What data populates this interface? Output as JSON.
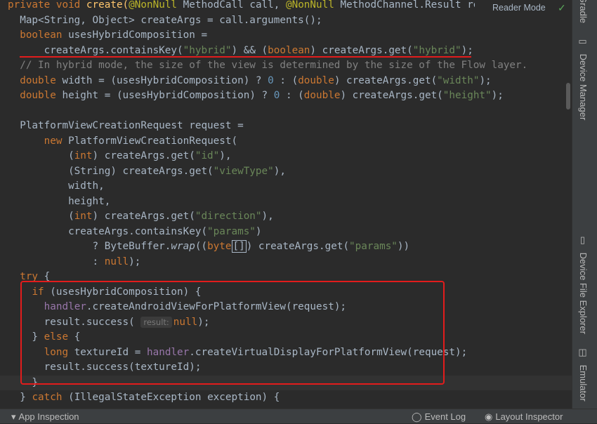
{
  "editor": {
    "reader_mode_label": "Reader Mode",
    "code_lines": [
      [
        [
          "private void ",
          "kw"
        ],
        [
          "create(",
          "fn"
        ],
        [
          "@NonNull",
          "ann"
        ],
        [
          " MethodCall call, ",
          ""
        ],
        [
          "@NonNull",
          "ann"
        ],
        [
          " MethodChannel.Result result)",
          ""
        ]
      ],
      [
        [
          "  Map<String, Object> createArgs = call.arguments();",
          ""
        ]
      ],
      [
        [
          "  boolean",
          "kw"
        ],
        [
          " usesHybridComposition =",
          ""
        ]
      ],
      [
        [
          "      createArgs.containsKey(",
          ""
        ],
        [
          "\"hybrid\"",
          "str"
        ],
        [
          ") && (",
          ""
        ],
        [
          "boolean",
          "kw"
        ],
        [
          ") createArgs.get(",
          ""
        ],
        [
          "\"hybrid\"",
          "str"
        ],
        [
          ");",
          ""
        ]
      ],
      [
        [
          "  // In hybrid mode, the size of the view is determined by the size of the Flow layer.",
          "cm"
        ]
      ],
      [
        [
          "  double",
          "kw"
        ],
        [
          " width = (usesHybridComposition) ? ",
          ""
        ],
        [
          "0",
          "num"
        ],
        [
          " : (",
          ""
        ],
        [
          "double",
          "kw"
        ],
        [
          ") createArgs.get(",
          ""
        ],
        [
          "\"width\"",
          "str"
        ],
        [
          ");",
          ""
        ]
      ],
      [
        [
          "  double",
          "kw"
        ],
        [
          " height = (usesHybridComposition) ? ",
          ""
        ],
        [
          "0",
          "num"
        ],
        [
          " : (",
          ""
        ],
        [
          "double",
          "kw"
        ],
        [
          ") createArgs.get(",
          ""
        ],
        [
          "\"height\"",
          "str"
        ],
        [
          ");",
          ""
        ]
      ],
      [],
      [
        [
          "  PlatformViewCreationRequest request =",
          ""
        ]
      ],
      [
        [
          "      ",
          ""
        ],
        [
          "new",
          "kw"
        ],
        [
          " PlatformViewCreationRequest(",
          ""
        ]
      ],
      [
        [
          "          (",
          ""
        ],
        [
          "int",
          "kw"
        ],
        [
          ") createArgs.get(",
          ""
        ],
        [
          "\"id\"",
          "str"
        ],
        [
          "),",
          ""
        ]
      ],
      [
        [
          "          (String) createArgs.get(",
          ""
        ],
        [
          "\"viewType\"",
          "str"
        ],
        [
          "),",
          ""
        ]
      ],
      [
        [
          "          width,",
          ""
        ]
      ],
      [
        [
          "          height,",
          ""
        ]
      ],
      [
        [
          "          (",
          ""
        ],
        [
          "int",
          "kw"
        ],
        [
          ") createArgs.get(",
          ""
        ],
        [
          "\"direction\"",
          "str"
        ],
        [
          "),",
          ""
        ]
      ],
      [
        [
          "          createArgs.containsKey(",
          ""
        ],
        [
          "\"params\"",
          "str"
        ],
        [
          ")",
          ""
        ]
      ],
      [
        [
          "              ? ByteBuffer.",
          ""
        ],
        [
          "wrap",
          "it"
        ],
        [
          "((",
          ""
        ],
        [
          "byte",
          "kw"
        ],
        [
          "[]",
          "box"
        ],
        [
          ") createArgs.get(",
          ""
        ],
        [
          "\"params\"",
          "str"
        ],
        [
          "))",
          ""
        ]
      ],
      [
        [
          "              : ",
          ""
        ],
        [
          "null",
          "kw"
        ],
        [
          ");",
          ""
        ]
      ],
      [
        [
          "  try",
          "kw"
        ],
        [
          " {",
          ""
        ]
      ],
      [
        [
          "    ",
          ""
        ],
        [
          "if",
          "kw"
        ],
        [
          " (usesHybridComposition) {",
          ""
        ]
      ],
      [
        [
          "      ",
          ""
        ],
        [
          "handler",
          "field"
        ],
        [
          ".createAndroidViewForPlatformView(request);",
          ""
        ]
      ],
      [
        [
          "      result.success( ",
          ""
        ],
        [
          "result:",
          "hint"
        ],
        [
          "null",
          "kw"
        ],
        [
          ");",
          ""
        ]
      ],
      [
        [
          "    } ",
          ""
        ],
        [
          "else",
          "kw"
        ],
        [
          " {",
          ""
        ]
      ],
      [
        [
          "      ",
          ""
        ],
        [
          "long",
          "kw"
        ],
        [
          " textureId = ",
          ""
        ],
        [
          "handler",
          "field"
        ],
        [
          ".createVirtualDisplayForPlatformView(request);",
          ""
        ]
      ],
      [
        [
          "      result.success(textureId);",
          ""
        ]
      ],
      [
        [
          "    }",
          ""
        ]
      ],
      [
        [
          "  } ",
          ""
        ],
        [
          "catch",
          "kw"
        ],
        [
          " (IllegalStateException exception) {",
          ""
        ]
      ]
    ]
  },
  "right_sidebar": {
    "tabs": [
      {
        "label": "Gradle",
        "icon": "gradle-icon"
      },
      {
        "label": "Device Manager",
        "icon": "device-manager-icon"
      },
      {
        "label": "Device File Explorer",
        "icon": "device-file-explorer-icon"
      },
      {
        "label": "Emulator",
        "icon": "emulator-icon"
      }
    ]
  },
  "status_bar": {
    "app_inspection": "App Inspection",
    "event_log": "Event Log",
    "layout_inspector": "Layout Inspector"
  }
}
